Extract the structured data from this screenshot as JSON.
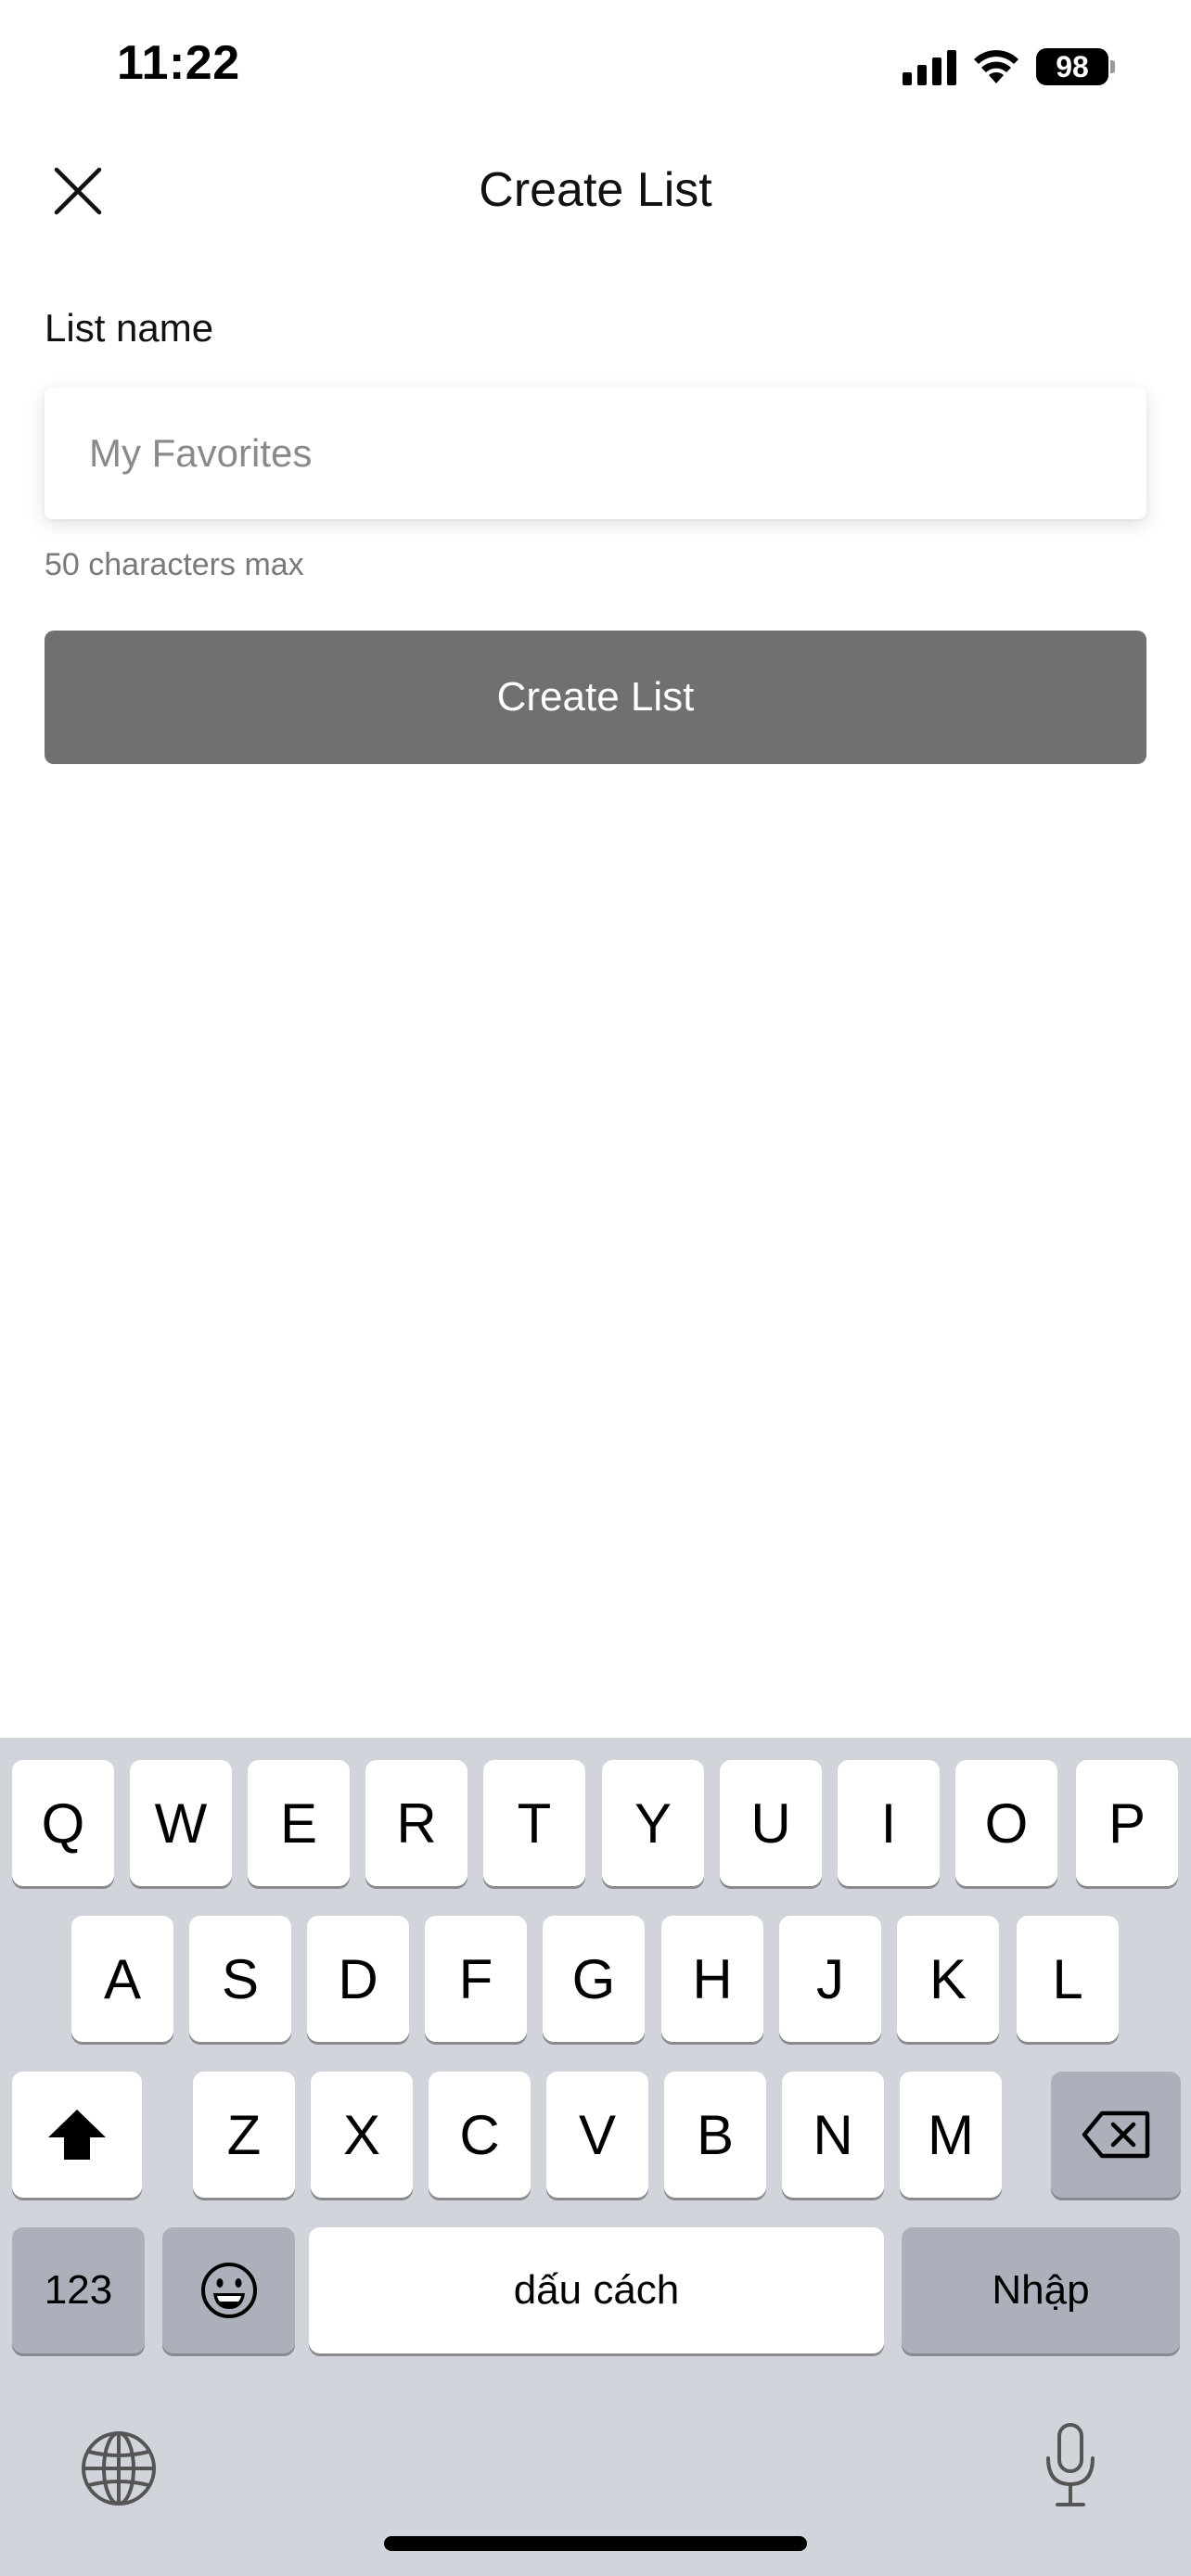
{
  "status_bar": {
    "time": "11:22",
    "battery": "98",
    "icons": [
      "cellular-signal-icon",
      "wifi-icon",
      "battery-icon"
    ]
  },
  "header": {
    "title": "Create List",
    "close_icon": "close-icon"
  },
  "form": {
    "label": "List name",
    "placeholder": "My Favorites",
    "value": "",
    "helper": "50 characters max",
    "submit_label": "Create List",
    "submit_color": "#707070"
  },
  "keyboard": {
    "row1": [
      "Q",
      "W",
      "E",
      "R",
      "T",
      "Y",
      "U",
      "I",
      "O",
      "P"
    ],
    "row2": [
      "A",
      "S",
      "D",
      "F",
      "G",
      "H",
      "J",
      "K",
      "L"
    ],
    "row3": [
      "Z",
      "X",
      "C",
      "V",
      "B",
      "N",
      "M"
    ],
    "numbers_label": "123",
    "space_label": "dấu cách",
    "return_label": "Nhập",
    "icons": [
      "shift-icon",
      "backspace-icon",
      "emoji-icon",
      "globe-icon",
      "microphone-icon"
    ],
    "background_color": "#d1d4da"
  }
}
